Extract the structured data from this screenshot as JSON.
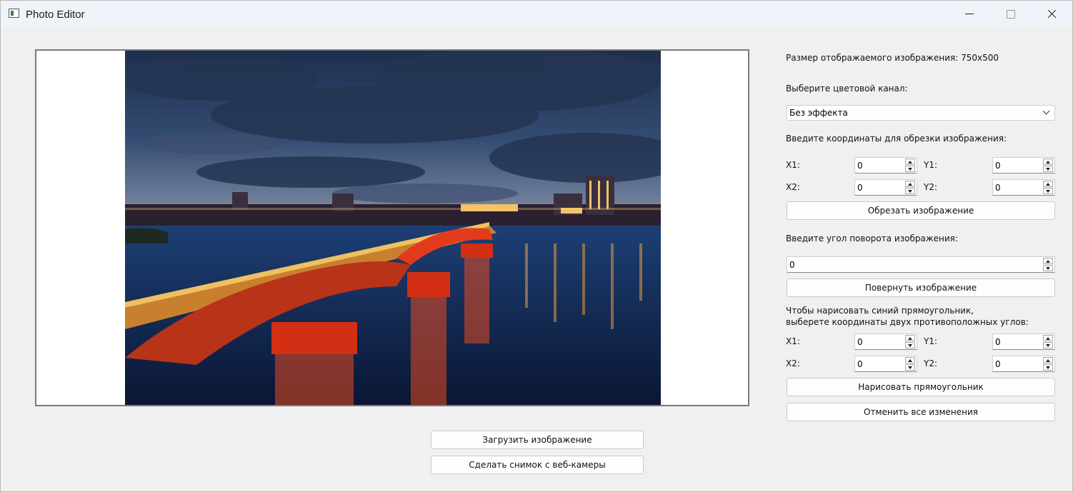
{
  "window": {
    "title": "Photo Editor",
    "icon": "photo-app-icon"
  },
  "photo": {
    "description_icon": "image"
  },
  "controls": {
    "image_size_label": "Размер отображаемого изображения: 750x500",
    "channel_label": "Выберите цветовой канал:",
    "channel_value": "Без эффекта",
    "crop_label": "Введите координаты для обрезки изображения:",
    "crop": {
      "x1_label": "X1:",
      "x1": "0",
      "y1_label": "Y1:",
      "y1": "0",
      "x2_label": "X2:",
      "x2": "0",
      "y2_label": "Y2:",
      "y2": "0"
    },
    "crop_button": "Обрезать изображение",
    "rotate_label": "Введите угол поворота изображения:",
    "rotate_value": "0",
    "rotate_button": "Повернуть изображение",
    "rect_label_1": "Чтобы нарисовать синий прямоугольник,",
    "rect_label_2": "выберете координаты двух противоположных углов:",
    "rect": {
      "x1_label": "X1:",
      "x1": "0",
      "y1_label": "Y1:",
      "y1": "0",
      "x2_label": "X2:",
      "x2": "0",
      "y2_label": "Y2:",
      "y2": "0"
    },
    "draw_button": "Нарисовать прямоугольник",
    "reset_button": "Отменить все изменения"
  },
  "bottom": {
    "load_button": "Загрузить изображение",
    "webcam_button": "Сделать снимок с веб-камеры"
  }
}
